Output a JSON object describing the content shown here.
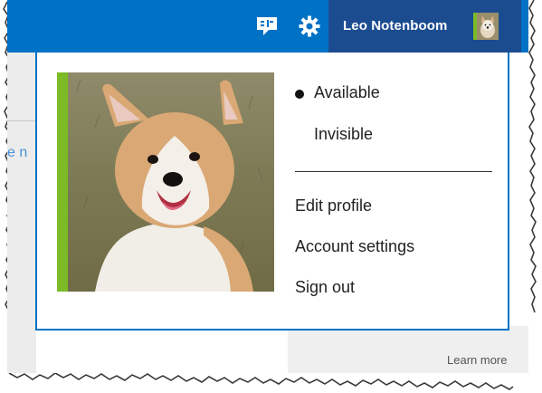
{
  "topbar": {
    "chat_icon": "chat-bubble-icon",
    "settings_icon": "gear-icon",
    "user_name": "Leo Notenboom",
    "avatar_icon": "avatar-dog-icon",
    "colors": {
      "bar": "#0072c6",
      "user_block": "#1c4c90"
    }
  },
  "background": {
    "fragment_text": "e n",
    "learn_more": "Learn more"
  },
  "dropdown": {
    "status": [
      {
        "label": "Available",
        "selected": true
      },
      {
        "label": "Invisible",
        "selected": false
      }
    ],
    "actions": [
      {
        "label": "Edit profile"
      },
      {
        "label": "Account settings"
      },
      {
        "label": "Sign out"
      }
    ],
    "colors": {
      "border": "#0072c6",
      "accent": "#7cba26"
    }
  }
}
